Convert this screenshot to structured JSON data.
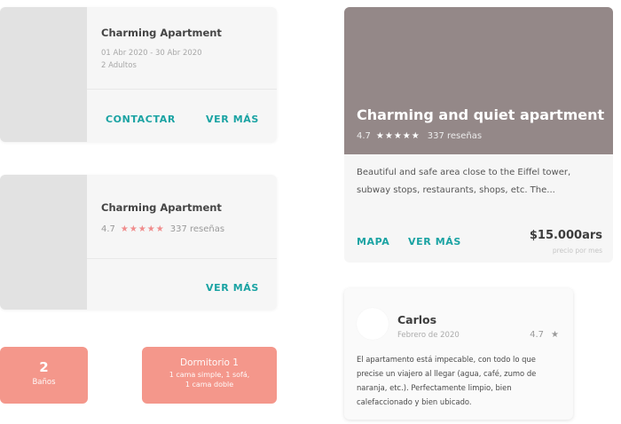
{
  "card1": {
    "title": "Charming Apartment",
    "dates": "01 Abr 2020 - 30 Abr 2020",
    "guests": "2 Adultos",
    "contact_label": "CONTACTAR",
    "more_label": "VER MÁS"
  },
  "card2": {
    "title": "Charming Apartment",
    "rating": "4.7",
    "stars": "★★★★★",
    "reviews": "337 reseñas",
    "more_label": "VER MÁS"
  },
  "tile_baths": {
    "count": "2",
    "label": "Baños"
  },
  "tile_room": {
    "title": "Dormitorio 1",
    "line1": "1 cama simple, 1 sofá,",
    "line2": "1 cama doble"
  },
  "feature": {
    "title": "Charming and quiet apartment",
    "rating": "4.7",
    "stars": "★★★★★",
    "reviews": "337 reseñas",
    "description": "Beautiful and safe area close to the Eiffel tower, subway stops, restaurants, shops, etc. The...",
    "map_label": "MAPA",
    "more_label": "VER MÁS",
    "price": "$15.000ars",
    "price_sub": "precio por mes"
  },
  "review": {
    "name": "Carlos",
    "date": "Febrero de 2020",
    "score": "4.7",
    "star": "★",
    "text": "El apartamento está impecable, con todo lo que precise un viajero al llegar (agua, café, zumo de naranja, etc.). Perfectamente limpio, bien calefaccionado y bien ubicado."
  },
  "colors": {
    "accent": "#1aa3a3",
    "salmon": "#f4978b",
    "hero": "#948888",
    "stars": "#f08c8c"
  }
}
